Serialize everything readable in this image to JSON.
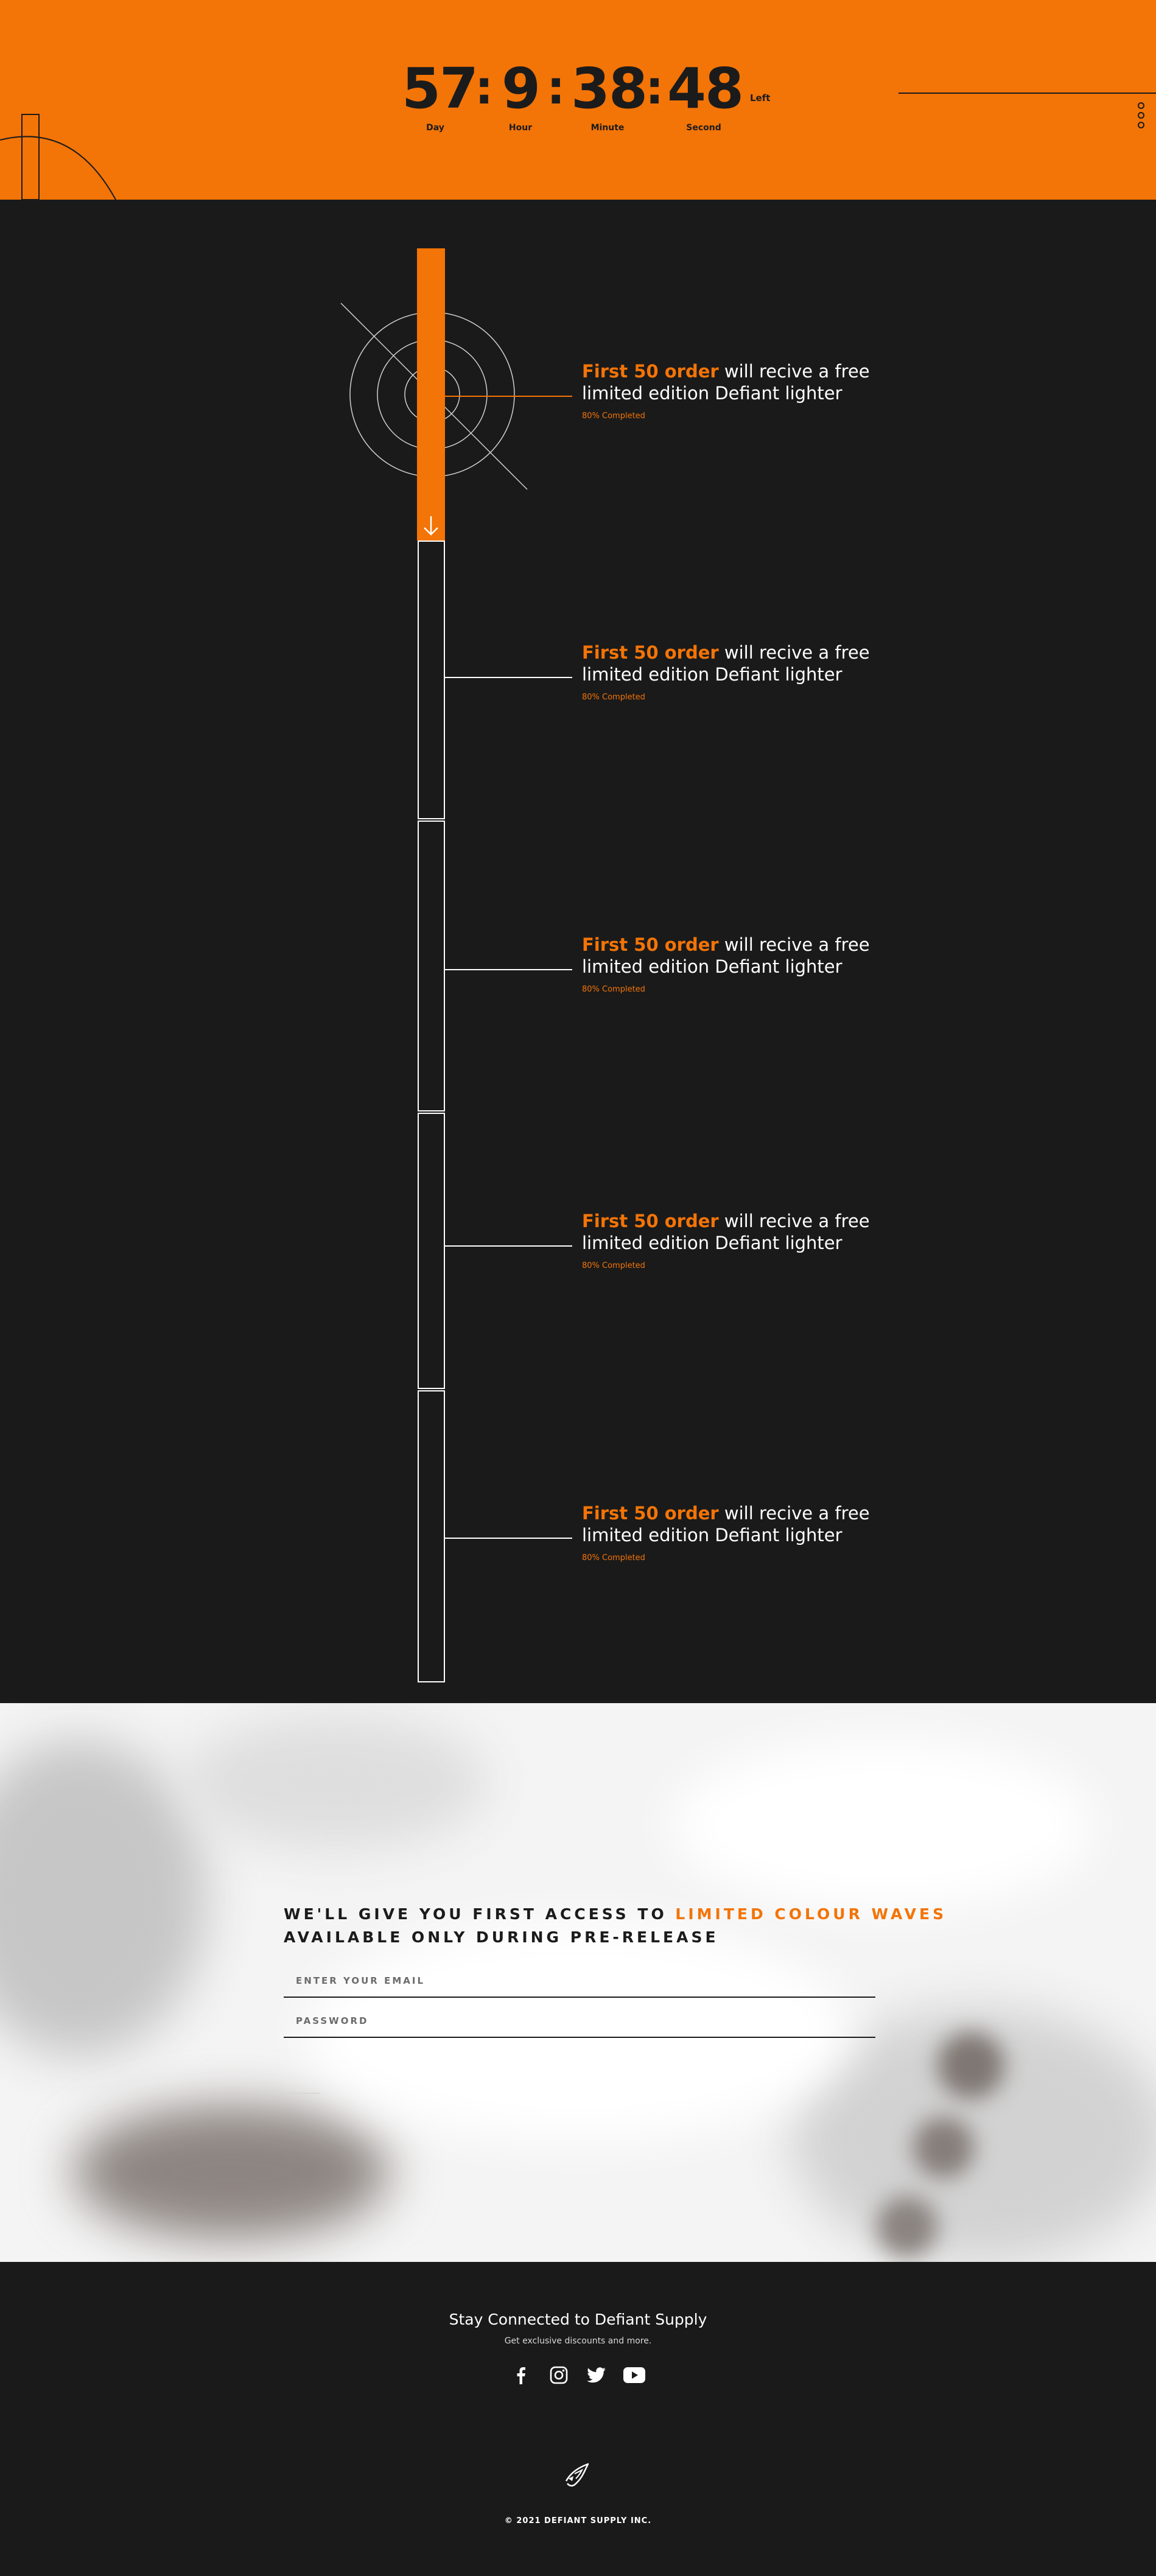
{
  "countdown": {
    "day": "57",
    "hour": "9",
    "minute": "38",
    "second": "48",
    "separator": ":",
    "day_label": "Day",
    "hour_label": "Hour",
    "minute_label": "Minute",
    "second_label": "Second",
    "suffix": "Left"
  },
  "timeline": {
    "progress_fraction": 0.18,
    "milestones": [
      {
        "highlight": "First 50 order",
        "text": " will recive a free limited edition Defiant lighter",
        "status": "80% Completed"
      },
      {
        "highlight": "First 50 order",
        "text": " will recive a free limited edition Defiant lighter",
        "status": "80% Completed"
      },
      {
        "highlight": "First 50 order",
        "text": " will recive a free limited edition Defiant lighter",
        "status": "80% Completed"
      },
      {
        "highlight": "First 50 order",
        "text": " will recive a free limited edition Defiant lighter",
        "status": "80% Completed"
      },
      {
        "highlight": "First 50 order",
        "text": " will recive a free limited edition Defiant lighter",
        "status": "80% Completed"
      }
    ]
  },
  "signup": {
    "heading_pre": "WE'LL GIVE YOU FIRST ACCESS TO ",
    "heading_highlight": "LIMITED COLOUR WAVES",
    "heading_post": "AVAILABLE ONLY DURING PRE-RELEASE",
    "email_placeholder": "ENTER YOUR EMAIL",
    "password_placeholder": "PASSWORD"
  },
  "footer": {
    "title": "Stay Connected to Defiant Supply",
    "subtitle": "Get exclusive discounts and more.",
    "socials": [
      "facebook-icon",
      "instagram-icon",
      "twitter-icon",
      "youtube-icon"
    ],
    "copyright": "© 2021 DEFIANT SUPPLY INC."
  },
  "colors": {
    "accent": "#f37407",
    "dark": "#1a1a1a",
    "text_light": "#ffffff"
  }
}
